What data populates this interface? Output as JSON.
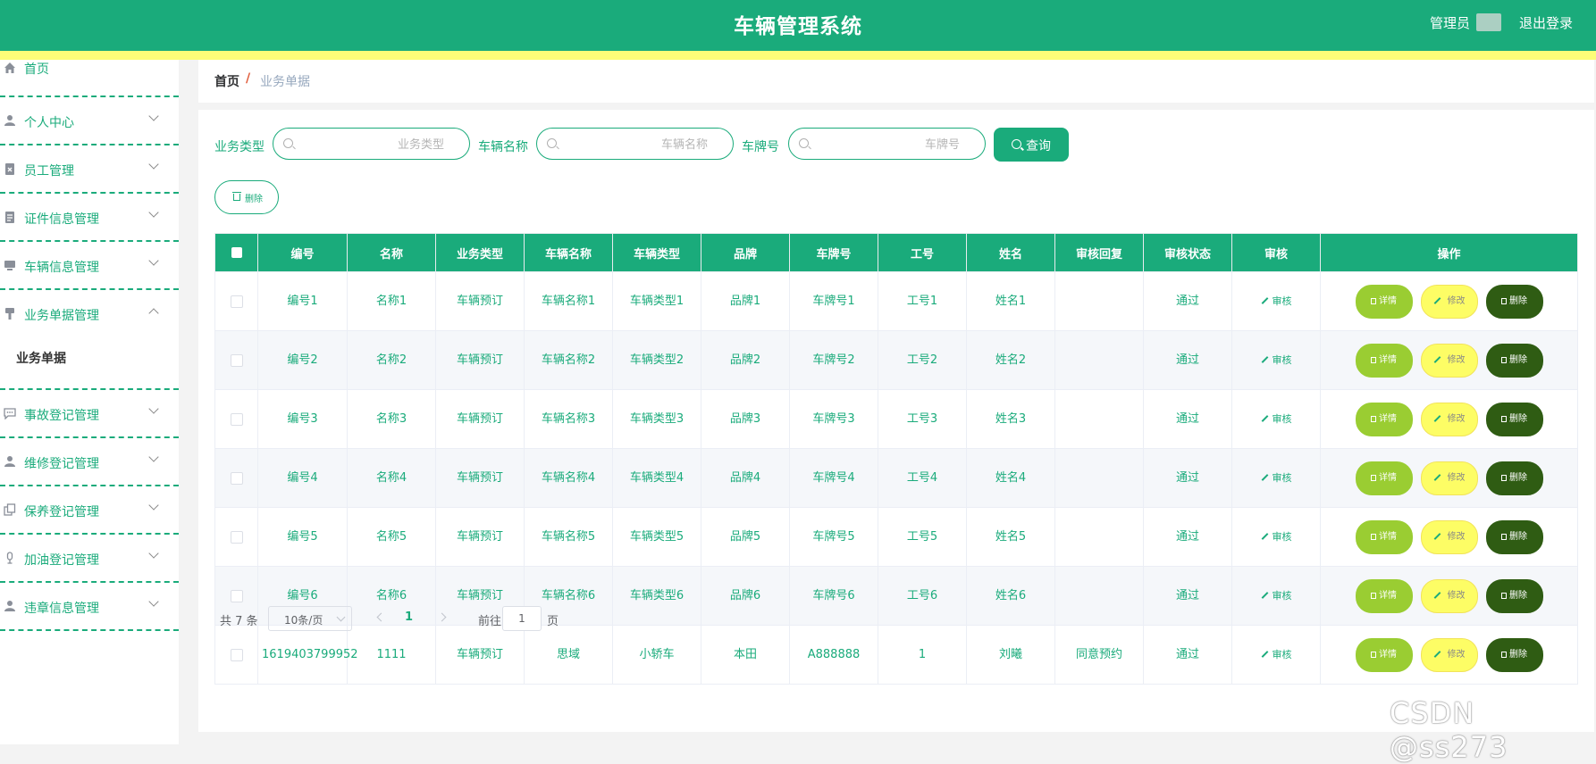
{
  "header": {
    "title": "车辆管理系统",
    "user_label": "管理员",
    "logout_label": "退出登录"
  },
  "sidebar": {
    "items": [
      {
        "label": "首页",
        "icon": "home-icon"
      },
      {
        "label": "个人中心",
        "icon": "user-icon"
      },
      {
        "label": "员工管理",
        "icon": "clipboard-icon"
      },
      {
        "label": "证件信息管理",
        "icon": "document-icon"
      },
      {
        "label": "车辆信息管理",
        "icon": "monitor-icon"
      },
      {
        "label": "业务单据管理",
        "icon": "brush-icon",
        "expanded": true,
        "children": [
          "业务单据"
        ]
      },
      {
        "label": "事故登记管理",
        "icon": "chat-icon"
      },
      {
        "label": "维修登记管理",
        "icon": "user-icon"
      },
      {
        "label": "保养登记管理",
        "icon": "copy-icon"
      },
      {
        "label": "加油登记管理",
        "icon": "microphone-icon"
      },
      {
        "label": "违章信息管理",
        "icon": "user-icon"
      }
    ]
  },
  "breadcrumb": {
    "home": "首页",
    "separator": "/",
    "current": "业务单据"
  },
  "search": {
    "fields": [
      {
        "label": "业务类型",
        "placeholder": "业务类型"
      },
      {
        "label": "车辆名称",
        "placeholder": "车辆名称"
      },
      {
        "label": "车牌号",
        "placeholder": "车牌号"
      }
    ],
    "query_label": "查询"
  },
  "toolbar": {
    "delete_label": "删除"
  },
  "table": {
    "columns": [
      "编号",
      "名称",
      "业务类型",
      "车辆名称",
      "车辆类型",
      "品牌",
      "车牌号",
      "工号",
      "姓名",
      "审核回复",
      "审核状态",
      "审核",
      "操作"
    ],
    "rows": [
      {
        "c": [
          "编号1",
          "名称1",
          "车辆预订",
          "车辆名称1",
          "车辆类型1",
          "品牌1",
          "车牌号1",
          "工号1",
          "姓名1",
          "",
          "通过"
        ]
      },
      {
        "c": [
          "编号2",
          "名称2",
          "车辆预订",
          "车辆名称2",
          "车辆类型2",
          "品牌2",
          "车牌号2",
          "工号2",
          "姓名2",
          "",
          "通过"
        ]
      },
      {
        "c": [
          "编号3",
          "名称3",
          "车辆预订",
          "车辆名称3",
          "车辆类型3",
          "品牌3",
          "车牌号3",
          "工号3",
          "姓名3",
          "",
          "通过"
        ]
      },
      {
        "c": [
          "编号4",
          "名称4",
          "车辆预订",
          "车辆名称4",
          "车辆类型4",
          "品牌4",
          "车牌号4",
          "工号4",
          "姓名4",
          "",
          "通过"
        ]
      },
      {
        "c": [
          "编号5",
          "名称5",
          "车辆预订",
          "车辆名称5",
          "车辆类型5",
          "品牌5",
          "车牌号5",
          "工号5",
          "姓名5",
          "",
          "通过"
        ]
      },
      {
        "c": [
          "编号6",
          "名称6",
          "车辆预订",
          "车辆名称6",
          "车辆类型6",
          "品牌6",
          "车牌号6",
          "工号6",
          "姓名6",
          "",
          "通过"
        ]
      },
      {
        "c": [
          "1619403799952",
          "1111",
          "车辆预订",
          "思域",
          "小轿车",
          "本田",
          "A888888",
          "1",
          "刘曦",
          "同意预约",
          "通过"
        ]
      }
    ],
    "audit_label": "审核",
    "actions": {
      "detail": "详情",
      "edit": "修改",
      "delete": "删除"
    }
  },
  "pagination": {
    "total_text": "共 7 条",
    "page_size": "10条/页",
    "current_page": "1",
    "goto_label": "前往",
    "goto_value": "1",
    "page_suffix": "页"
  },
  "watermark": "CSDN @ss273",
  "colors": {
    "primary": "#1aab7b",
    "stripe": "#fdfd78",
    "detail": "#9acd32",
    "edit": "#fdfd65",
    "delete": "#2f5c13"
  }
}
